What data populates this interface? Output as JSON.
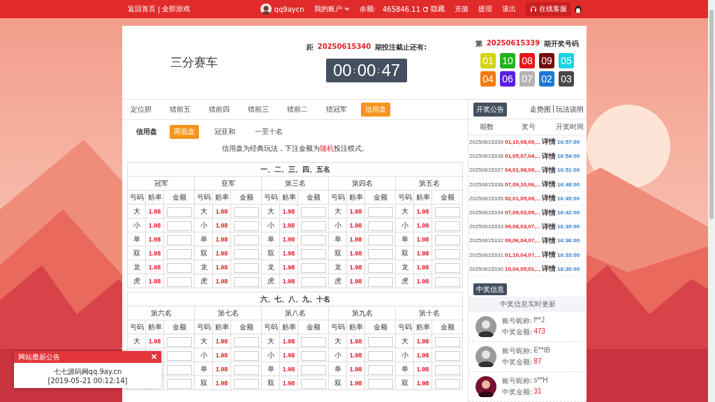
{
  "top_bar": {
    "links": [
      "返回首页",
      "全部游戏"
    ],
    "link_separator": "|",
    "username": "qq9aycn",
    "account_menu": "我的账户",
    "balance_label": "余额:",
    "balance": "465846.11",
    "hide_label": "隐藏",
    "actions": [
      "充值",
      "提现",
      "退出"
    ],
    "support": "在线客服"
  },
  "game": {
    "title": "三分赛车",
    "countdown_prefix": "距",
    "countdown_issue": "20250615340",
    "countdown_suffix": "期投注截止还有:",
    "timer": [
      "00",
      "00",
      "47"
    ],
    "timer_separator": ":",
    "draw_prefix": "第",
    "draw_issue": "20250615339",
    "draw_suffix": "期开奖号码",
    "balls": [
      {
        "number": "01",
        "color": "#d4d412"
      },
      {
        "number": "10",
        "color": "#23b21a"
      },
      {
        "number": "08",
        "color": "#e8161c"
      },
      {
        "number": "09",
        "color": "#760b0b"
      },
      {
        "number": "05",
        "color": "#1ad3df"
      },
      {
        "number": "04",
        "color": "#f57a0c"
      },
      {
        "number": "06",
        "color": "#5a1fe6"
      },
      {
        "number": "07",
        "color": "#b3b3b3"
      },
      {
        "number": "02",
        "color": "#1b78d8"
      },
      {
        "number": "03",
        "color": "#484848"
      }
    ]
  },
  "tabs": [
    {
      "label": "定位胆",
      "selected": false
    },
    {
      "label": "猜前五",
      "selected": false
    },
    {
      "label": "猜前四",
      "selected": false
    },
    {
      "label": "猜前三",
      "selected": false
    },
    {
      "label": "猜前二",
      "selected": false
    },
    {
      "label": "猜冠军",
      "selected": false
    },
    {
      "label": "信用盘",
      "selected": true
    }
  ],
  "sub_tabs": {
    "label": "信用盘",
    "items": [
      {
        "label": "两面盘",
        "selected": true
      },
      {
        "label": "冠亚和",
        "selected": false
      },
      {
        "label": "一至十名",
        "selected": false
      }
    ]
  },
  "notice": "信用盘为经典玩法，下注金额为**随机**投注模式。",
  "bet_tables": [
    {
      "title": "一、二、三、四、五名",
      "groups": [
        {
          "name": "冠军",
          "columns": [
            "号码",
            "赔率",
            "金额"
          ]
        },
        {
          "name": "亚军",
          "columns": [
            "号码",
            "赔率",
            "金额"
          ]
        },
        {
          "name": "第三名",
          "columns": [
            "号码",
            "赔率",
            "金额"
          ]
        },
        {
          "name": "第四名",
          "columns": [
            "号码",
            "赔率",
            "金额"
          ]
        },
        {
          "name": "第五名",
          "columns": [
            "号码",
            "赔率",
            "金额"
          ]
        }
      ],
      "rows": [
        {
          "cells": [
            {
              "label": "大",
              "odds": "1.98"
            },
            {
              "label": "大",
              "odds": "1.98"
            },
            {
              "label": "大",
              "odds": "1.98"
            },
            {
              "label": "大",
              "odds": "1.98"
            },
            {
              "label": "大",
              "odds": "1.98"
            }
          ]
        },
        {
          "cells": [
            {
              "label": "小",
              "odds": "1.98"
            },
            {
              "label": "小",
              "odds": "1.98"
            },
            {
              "label": "小",
              "odds": "1.98"
            },
            {
              "label": "小",
              "odds": "1.98"
            },
            {
              "label": "小",
              "odds": "1.98"
            }
          ]
        },
        {
          "cells": [
            {
              "label": "单",
              "odds": "1.98"
            },
            {
              "label": "单",
              "odds": "1.98"
            },
            {
              "label": "单",
              "odds": "1.98"
            },
            {
              "label": "单",
              "odds": "1.98"
            },
            {
              "label": "单",
              "odds": "1.98"
            }
          ]
        },
        {
          "cells": [
            {
              "label": "双",
              "odds": "1.98"
            },
            {
              "label": "双",
              "odds": "1.98"
            },
            {
              "label": "双",
              "odds": "1.98"
            },
            {
              "label": "双",
              "odds": "1.98"
            },
            {
              "label": "双",
              "odds": "1.98"
            }
          ]
        },
        {
          "cells": [
            {
              "label": "龙",
              "odds": "1.98"
            },
            {
              "label": "龙",
              "odds": "1.98"
            },
            {
              "label": "龙",
              "odds": "1.98"
            },
            {
              "label": "龙",
              "odds": "1.98"
            },
            {
              "label": "龙",
              "odds": "1.98"
            }
          ]
        },
        {
          "cells": [
            {
              "label": "虎",
              "odds": "1.98"
            },
            {
              "label": "虎",
              "odds": "1.98"
            },
            {
              "label": "虎",
              "odds": "1.98"
            },
            {
              "label": "虎",
              "odds": "1.98"
            },
            {
              "label": "虎",
              "odds": "1.98"
            }
          ]
        }
      ]
    },
    {
      "title": "六、七、八、九、十名",
      "groups": [
        {
          "name": "第六名",
          "columns": [
            "号码",
            "赔率",
            "金额"
          ]
        },
        {
          "name": "第七名",
          "columns": [
            "号码",
            "赔率",
            "金额"
          ]
        },
        {
          "name": "第八名",
          "columns": [
            "号码",
            "赔率",
            "金额"
          ]
        },
        {
          "name": "第九名",
          "columns": [
            "号码",
            "赔率",
            "金额"
          ]
        },
        {
          "name": "第十名",
          "columns": [
            "号码",
            "赔率",
            "金额"
          ]
        }
      ],
      "rows": [
        {
          "cells": [
            {
              "label": "大",
              "odds": "1.98"
            },
            {
              "label": "大",
              "odds": "1.98"
            },
            {
              "label": "大",
              "odds": "1.98"
            },
            {
              "label": "大",
              "odds": "1.98"
            },
            {
              "label": "大",
              "odds": "1.98"
            }
          ]
        },
        {
          "cells": [
            {},
            {
              "label": "小",
              "odds": "1.98"
            },
            {
              "label": "小",
              "odds": "1.98"
            },
            {
              "label": "小",
              "odds": "1.98"
            },
            {
              "label": "小",
              "odds": "1.98"
            }
          ]
        },
        {
          "cells": [
            {},
            {
              "label": "单",
              "odds": "1.98"
            },
            {
              "label": "单",
              "odds": "1.98"
            },
            {
              "label": "单",
              "odds": "1.98"
            },
            {
              "label": "单",
              "odds": "1.98"
            }
          ]
        },
        {
          "cells": [
            {},
            {
              "label": "双",
              "odds": "1.98"
            },
            {
              "label": "双",
              "odds": "1.98"
            },
            {
              "label": "双",
              "odds": "1.98"
            },
            {
              "label": "双",
              "odds": "1.98"
            }
          ]
        }
      ]
    }
  ],
  "sidebar": {
    "results_tab": "开奖公告",
    "links": [
      "走势图",
      "玩法说明"
    ],
    "link_separator": "|",
    "columns": [
      "期数",
      "奖号",
      "开奖时间"
    ],
    "results": [
      {
        "issue": "20250615339",
        "numbers": "01,10,08,09,...",
        "detail": "详情",
        "time": "16:57:00"
      },
      {
        "issue": "20250615338",
        "numbers": "01,05,07,04,...",
        "detail": "详情",
        "time": "16:54:00"
      },
      {
        "issue": "20250615337",
        "numbers": "04,01,08,09,...",
        "detail": "详情",
        "time": "16:51:00"
      },
      {
        "issue": "20250615336",
        "numbers": "07,09,10,06,...",
        "detail": "详情",
        "time": "16:48:00"
      },
      {
        "issue": "20250615335",
        "numbers": "02,01,05,09,...",
        "detail": "详情",
        "time": "16:45:00"
      },
      {
        "issue": "20250615334",
        "numbers": "07,09,03,05,...",
        "detail": "详情",
        "time": "16:42:00"
      },
      {
        "issue": "20250615333",
        "numbers": "09,08,03,07,...",
        "detail": "详情",
        "time": "16:39:00"
      },
      {
        "issue": "20250615332",
        "numbers": "09,06,04,07,...",
        "detail": "详情",
        "time": "16:36:00"
      },
      {
        "issue": "20250615331",
        "numbers": "01,10,04,07,...",
        "detail": "详情",
        "time": "16:33:00"
      },
      {
        "issue": "20250615330",
        "numbers": "10,04,05,01,...",
        "detail": "详情",
        "time": "16:30:00"
      }
    ],
    "winners_tab": "中奖信息",
    "winners_heading": "中奖信息实时更新",
    "winners": [
      {
        "name_label": "账号昵称:",
        "name": "f**J",
        "amount_label": "中奖金额:",
        "amount": "473"
      },
      {
        "name_label": "账号昵称:",
        "name": "E**IB",
        "amount_label": "中奖金额:",
        "amount": "87"
      },
      {
        "name_label": "账号昵称:",
        "name": "s**H",
        "amount_label": "中奖金额:",
        "amount": "31"
      }
    ]
  },
  "popup": {
    "title": "网站最新公告",
    "close": "✕",
    "lines": [
      "七七源码网qq.9ay.cn",
      "[2019-05-21 00:12:14]"
    ]
  }
}
